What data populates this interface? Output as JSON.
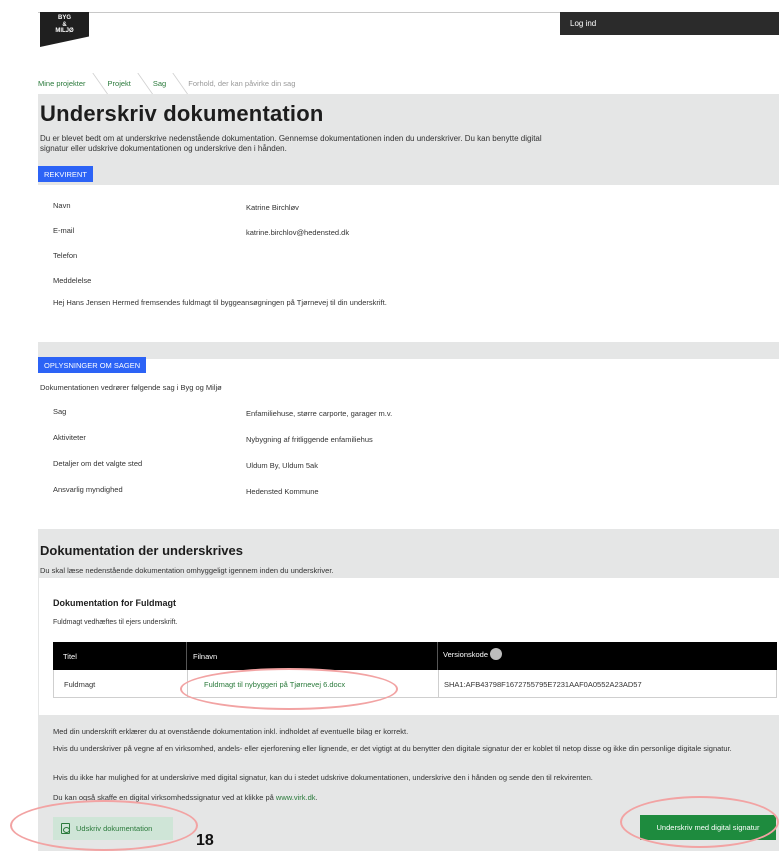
{
  "header": {
    "logo_lines": [
      "BYG",
      "&",
      "MILJØ"
    ],
    "login_label": "Log ind"
  },
  "breadcrumb": [
    {
      "label": "Mine projekter"
    },
    {
      "label": "Projekt"
    },
    {
      "label": "Sag"
    },
    {
      "label": "Forhold, der kan påvirke din sag"
    }
  ],
  "page": {
    "title": "Underskriv dokumentation",
    "intro": "Du er blevet bedt om at underskrive nedenstående dokumentation. Gennemse dokumentationen inden du underskriver. Du kan benytte digital signatur eller udskrive dokumentationen og underskrive den i hånden."
  },
  "rekvirent": {
    "tag": "REKVIRENT",
    "name_label": "Navn",
    "name_value": "Katrine Birchløv",
    "email_label": "E-mail",
    "email_value": "katrine.birchlov@hedensted.dk",
    "phone_label": "Telefon",
    "message_label": "Meddelelse",
    "message_value": "Hej Hans Jensen Hermed fremsendes fuldmagt til byggeansøgningen på Tjørnevej til din underskrift."
  },
  "sag": {
    "tag": "OPLYSNINGER OM SAGEN",
    "intro": "Dokumentationen vedrører følgende sag i Byg og Miljø",
    "sag_label": "Sag",
    "sag_value": "Enfamiliehuse, større carporte, garager m.v.",
    "aktiviteter_label": "Aktiviteter",
    "aktiviteter_value": "Nybygning af fritliggende enfamiliehus",
    "detaljer_label": "Detaljer om det valgte sted",
    "detaljer_value": "Uldum By, Uldum 5ak",
    "myndighed_label": "Ansvarlig myndighed",
    "myndighed_value": "Hedensted Kommune"
  },
  "dokumentation": {
    "title": "Dokumentation der underskrives",
    "subtitle": "Du skal læse nedenstående dokumentation omhyggeligt igennem inden du underskriver.",
    "doc_title": "Dokumentation for Fuldmagt",
    "doc_subtitle": "Fuldmagt vedhæftes til ejers underskrift.",
    "table": {
      "headers": {
        "title": "Titel",
        "filename": "Filnavn",
        "version": "Versionskode"
      },
      "row": {
        "title": "Fuldmagt",
        "filename": "Fuldmagt til nybyggeri på Tjørnevej 6.docx",
        "version": "SHA1:AFB43798F1672755795E7231AAF0A0552A23AD57"
      }
    }
  },
  "footer": {
    "p1": "Med din underskrift erklærer du at ovenstående dokumentation inkl. indholdet af eventuelle bilag er korrekt.",
    "p2": "Hvis du underskriver på vegne af en virksomhed, andels- eller ejerforening eller lignende, er det vigtigt at du benytter den digitale signatur der er koblet til netop disse og ikke din personlige digitale signatur.",
    "p3": "Hvis du ikke har mulighed for at underskrive med digital signatur, kan du i stedet udskrive dokumentationen, underskrive den i hånden og sende den til rekvirenten.",
    "p4_prefix": "Du kan også skaffe en digital virksomhedssignatur ved at klikke på ",
    "p4_link": "www.virk.dk",
    "p4_suffix": ".",
    "print_button": "Udskriv dokumentation",
    "sign_button": "Underskriv med digital signatur"
  },
  "annotation_number": "18",
  "colors": {
    "accent_blue": "#2c63f6",
    "link_green": "#2a7a3b",
    "sign_green": "#1e8b3e",
    "panel_grey": "#e5e6e6",
    "annotation_pink": "#f2a3a3"
  }
}
